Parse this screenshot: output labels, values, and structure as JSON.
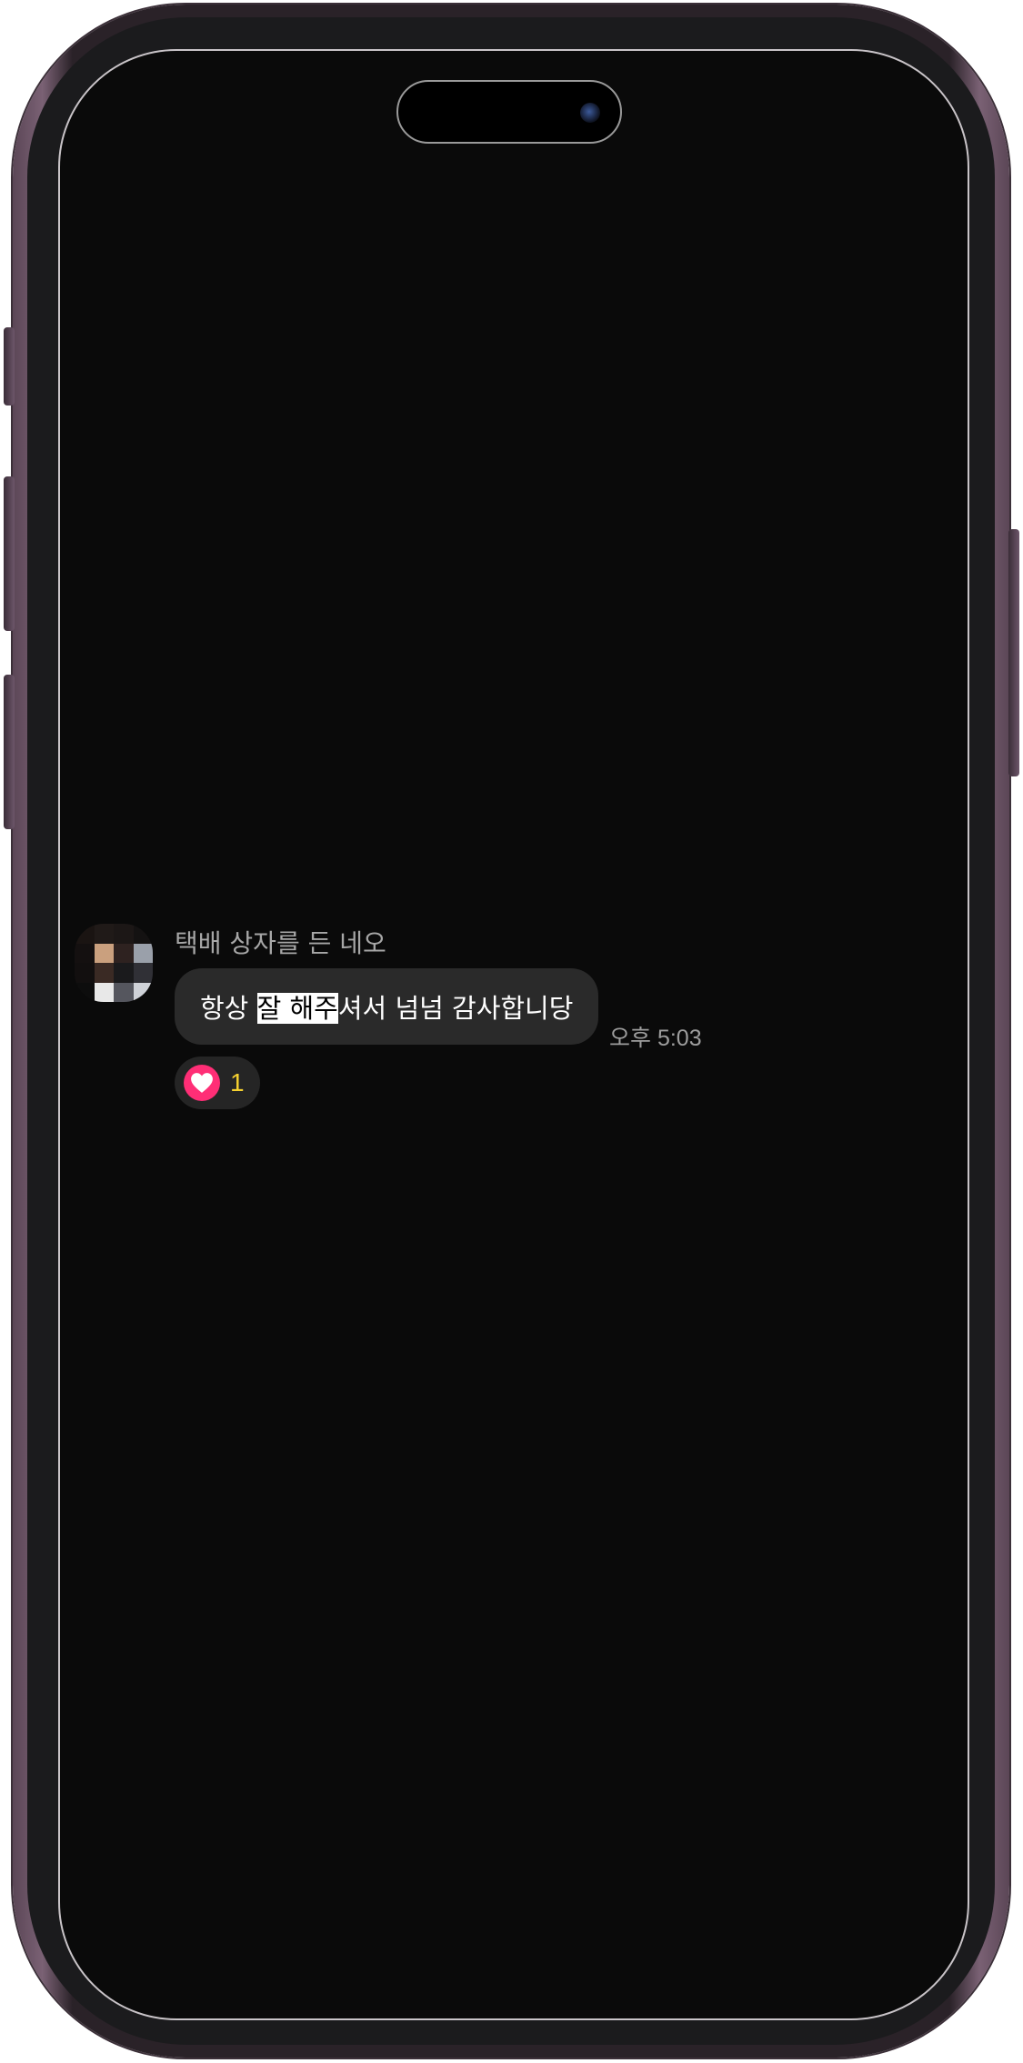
{
  "message": {
    "sender_name": "택배 상자를 든 네오",
    "text_before": "항상 ",
    "text_highlight": "잘 해주",
    "text_after": "셔서 넘넘 감사합니당",
    "timestamp": "오후 5:03",
    "reaction": {
      "icon": "heart-icon",
      "count": "1",
      "color": "#ff2e76",
      "count_color": "#f5d130"
    }
  },
  "colors": {
    "screen_bg": "#0a0a0a",
    "bubble_bg": "#2a2a2a",
    "highlight_bg": "#ffffff"
  }
}
